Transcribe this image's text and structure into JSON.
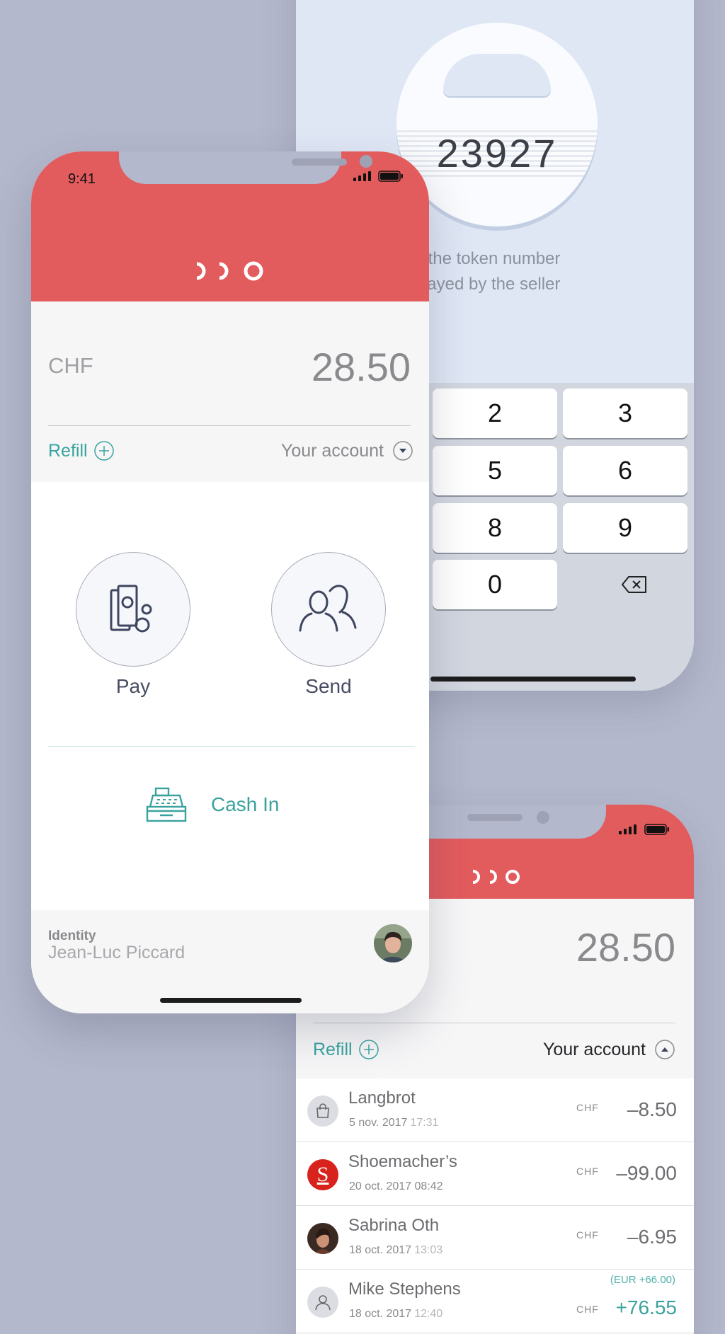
{
  "colors": {
    "brand_red": "#e25b5d",
    "accent_teal": "#39a39e",
    "background": "#b4b8cc",
    "panel_grey": "#f6f6f7"
  },
  "keypad_screen": {
    "token_number": "23927",
    "hint_line1": "e the token number",
    "hint_line2": "played by the seller",
    "keys": [
      {
        "label": "2"
      },
      {
        "label": "3"
      },
      {
        "label": "5"
      },
      {
        "label": "6"
      },
      {
        "label": "8"
      },
      {
        "label": "9"
      },
      {
        "label": "0"
      }
    ],
    "backspace_icon": "backspace-icon"
  },
  "main_screen": {
    "status_time": "9:41",
    "logo_icon": "brand-logo-icon",
    "currency": "CHF",
    "balance": "28.50",
    "refill_label": "Refill",
    "account_label": "Your account",
    "actions": {
      "pay_label": "Pay",
      "pay_icon": "pay-cash-icon",
      "send_label": "Send",
      "send_icon": "users-icon"
    },
    "cash_in_label": "Cash In",
    "cash_in_icon": "cash-register-icon",
    "identity_title": "Identity",
    "identity_name": "Jean-Luc Piccard"
  },
  "transactions_screen": {
    "balance": "28.50",
    "refill_label": "Refill",
    "account_label": "Your account",
    "transactions": [
      {
        "name": "Langbrot",
        "date": "5 nov. 2017",
        "time": "17:31",
        "currency": "CHF",
        "amount": "–8.50",
        "sub": "",
        "icon": "shopping-bag-icon"
      },
      {
        "name": "Shoemacher’s",
        "date": "20 oct. 2017",
        "time": "08:42",
        "currency": "CHF",
        "amount": "–99.00",
        "sub": "",
        "icon": "shoemacher-logo-icon"
      },
      {
        "name": "Sabrina Oth",
        "date": "18 oct. 2017",
        "time": "13:03",
        "currency": "CHF",
        "amount": "–6.95",
        "sub": "",
        "icon": "avatar-photo"
      },
      {
        "name": "Mike Stephens",
        "date": "18 oct. 2017",
        "time": "12:40",
        "currency": "CHF",
        "amount": "+76.55",
        "sub": "(EUR +66.00)",
        "icon": "user-icon"
      }
    ]
  }
}
